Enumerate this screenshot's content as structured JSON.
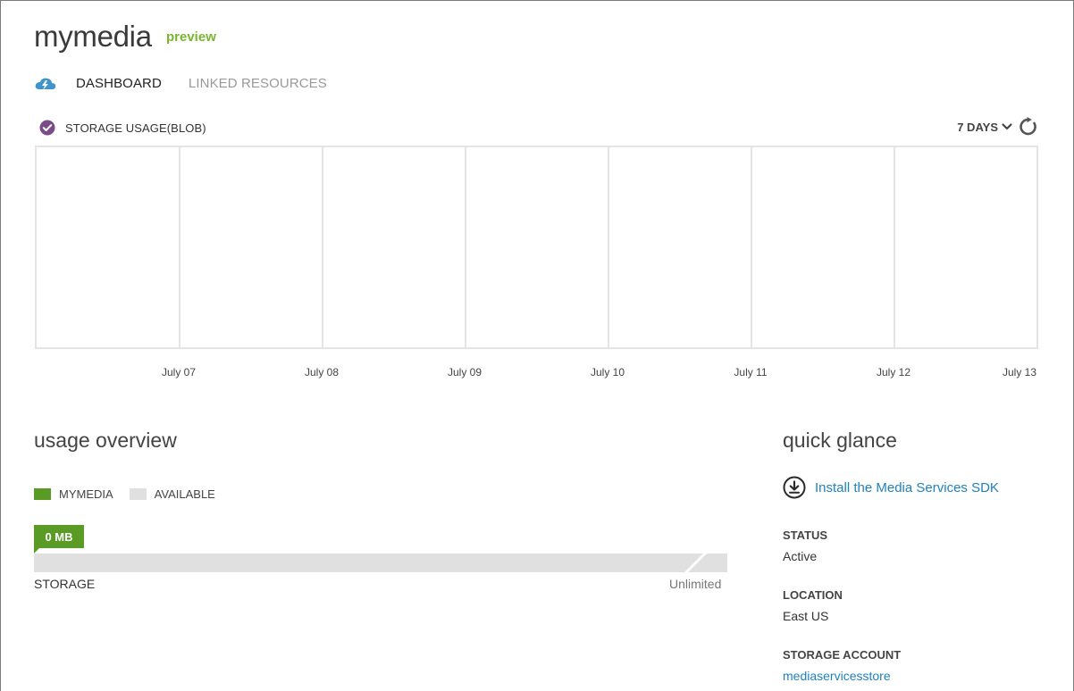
{
  "header": {
    "title": "mymedia",
    "badge": "preview"
  },
  "nav": {
    "icon": "cloud-lightning-icon",
    "tabs": [
      {
        "label": "DASHBOARD",
        "active": true
      },
      {
        "label": "LINKED RESOURCES",
        "active": false
      }
    ]
  },
  "metric": {
    "label": "STORAGE USAGE(BLOB)",
    "checked": true,
    "range_label": "7 DAYS",
    "range_icon": "chevron-down-icon",
    "refresh_icon": "refresh-icon"
  },
  "chart_data": {
    "type": "line",
    "x": [
      "July 07",
      "July 08",
      "July 09",
      "July 10",
      "July 11",
      "July 12",
      "July 13"
    ],
    "series": [],
    "grid": true
  },
  "usage_overview": {
    "title": "usage overview",
    "legend": [
      {
        "label": "MYMEDIA",
        "color": "#5a9b25"
      },
      {
        "label": "AVAILABLE",
        "color": "#e0e0e0"
      }
    ],
    "badge": "0 MB",
    "used_fraction": 0,
    "storage_label": "STORAGE",
    "limit_label": "Unlimited"
  },
  "quick_glance": {
    "title": "quick glance",
    "sdk_icon": "download-circle-icon",
    "sdk_link": "Install the Media Services SDK",
    "status_label": "STATUS",
    "status_value": "Active",
    "location_label": "LOCATION",
    "location_value": "East US",
    "account_label": "STORAGE ACCOUNT",
    "account_value": "mediaservicesstore"
  },
  "colors": {
    "accent_green": "#5a9b25",
    "preview_green": "#7ab531",
    "link_blue": "#1f82c0",
    "check_purple": "#7a4d8a"
  }
}
